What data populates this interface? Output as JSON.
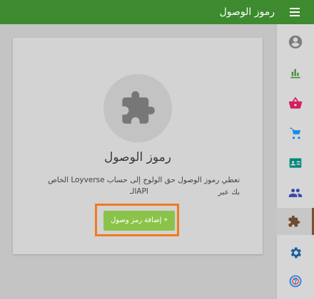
{
  "header": {
    "title": "رموز الوصول",
    "menu_icon": "hamburger-menu-icon",
    "bar_color": "#3d8b2e"
  },
  "card": {
    "icon": "puzzle-piece-icon",
    "heading": "رموز الوصول",
    "description_line1": "تعطي رموز الوصول حق الولوج إلى حساب Loyverse الخاص بك عبر",
    "description_line2": "الـAPI",
    "add_button_label": "+ إضافة رمز وصول",
    "button_color": "#8bc34a",
    "focus_color": "#f07a1e"
  },
  "sidebar": {
    "items": [
      {
        "icon": "account-circle-icon",
        "color": "#7d7d7d"
      },
      {
        "icon": "bar-chart-icon",
        "color": "#3d8b2e"
      },
      {
        "icon": "basket-icon",
        "color": "#d81b60"
      },
      {
        "icon": "cart-icon",
        "color": "#1e88e5"
      },
      {
        "icon": "id-card-icon",
        "color": "#00897b"
      },
      {
        "icon": "people-icon",
        "color": "#3949ab"
      },
      {
        "icon": "puzzle-piece-icon",
        "color": "#6d4c2f",
        "active": true
      },
      {
        "icon": "gear-icon",
        "color": "#1e5f9e"
      },
      {
        "icon": "help-icon",
        "color": "#1e88e5"
      }
    ]
  }
}
